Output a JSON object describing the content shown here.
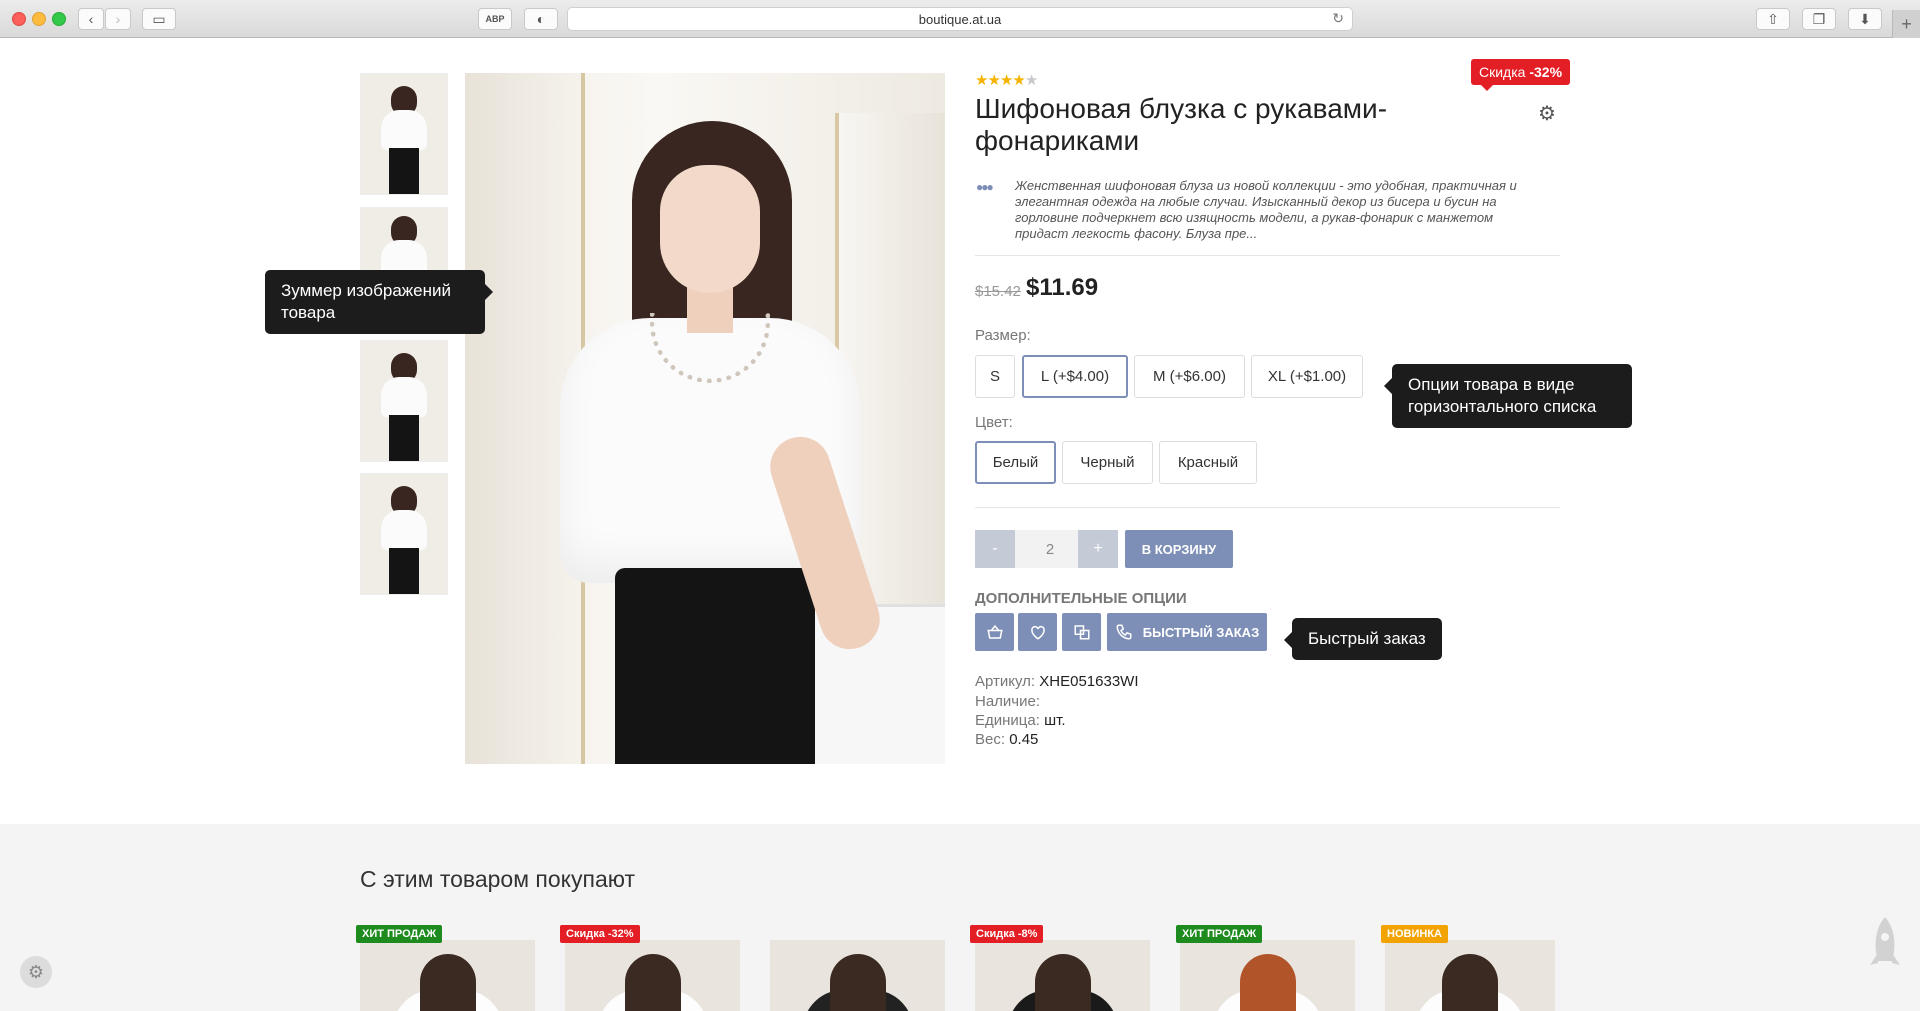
{
  "browser": {
    "url": "boutique.at.ua"
  },
  "product": {
    "rating": 4,
    "rating_max": 5,
    "discount_prefix": "Скидка ",
    "discount_value": "-32%",
    "title": "Шифоновая блузка с рукавами-фонариками",
    "description": "Женственная шифоновая блуза из новой коллекции - это удобная, практичная и элегантная одежда на любые случаи. Изысканный декор из бисера и бусин на горловине подчеркнет всю изящность модели, а рукав-фонарик с манжетом придаст легкость фасону. Блуза пре...",
    "old_price": "$15.42",
    "new_price": "$11.69",
    "size_label": "Размер:",
    "sizes": [
      "S",
      "L (+$4.00)",
      "M (+$6.00)",
      "XL (+$1.00)"
    ],
    "selected_size": "L (+$4.00)",
    "color_label": "Цвет:",
    "colors": [
      "Белый",
      "Черный",
      "Красный"
    ],
    "selected_color": "Белый",
    "qty_minus": "-",
    "qty_value": "2",
    "qty_plus": "+",
    "cart_label": "В КОРЗИНУ",
    "extra_label": "ДОПОЛНИТЕЛЬНЫЕ ОПЦИИ",
    "quick_order_label": "БЫСТРЫЙ ЗАКАЗ",
    "meta": {
      "sku_label": "Артикул:",
      "sku_value": "XHE051633WI",
      "stock_label": "Наличие:",
      "stock_value": "",
      "unit_label": "Единица:",
      "unit_value": "шт.",
      "weight_label": "Вес:",
      "weight_value": "0.45"
    }
  },
  "tooltips": {
    "zoom": "Зуммер изображений товара",
    "options": "Опции товара в виде горизонтального списка",
    "quick_order": "Быстрый заказ"
  },
  "related": {
    "title": "С этим товаром покупают",
    "badges": [
      {
        "text": "ХИТ ПРОДАЖ",
        "color": "#1e8b1e"
      },
      {
        "text": "Скидка -32%",
        "color": "#e31e24"
      },
      {
        "text": "",
        "color": ""
      },
      {
        "text": "Скидка -8%",
        "color": "#e31e24"
      },
      {
        "text": "ХИТ ПРОДАЖ",
        "color": "#1e8b1e"
      },
      {
        "text": "НОВИНКА",
        "color": "#f2a300"
      }
    ]
  },
  "colors": {
    "accent": "#7e8fb7",
    "sale": "#e31e24",
    "hit": "#1e8b1e",
    "new": "#f2a300"
  },
  "icons": {
    "cart": "basket-icon",
    "wishlist": "heart-icon",
    "compare": "compare-icon",
    "phone": "phone-icon",
    "settings": "gear-icon"
  }
}
